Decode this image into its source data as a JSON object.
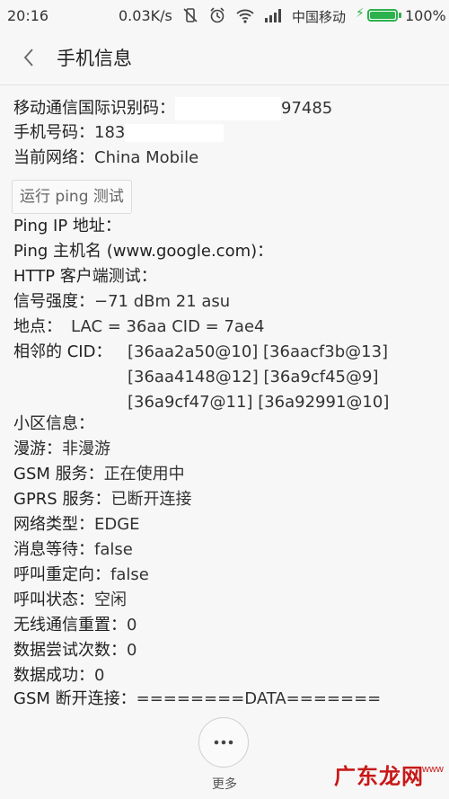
{
  "status_bar": {
    "time": "20:16",
    "net_speed": "0.03K/s",
    "carrier": "中国移动",
    "battery_pct": "100%",
    "battery_level": 1.0
  },
  "header": {
    "title": "手机信息"
  },
  "info": {
    "imei_label": "移动通信国际识别码：",
    "imei_value": "97485",
    "phone_label": "手机号码：",
    "phone_value": "183",
    "network_label": "当前网络：",
    "network_value": "China Mobile",
    "ping_button": "运行 ping 测试",
    "ping_ip_label": "Ping IP 地址：",
    "ping_host_label": "Ping 主机名 (www.google.com)：",
    "http_label": "HTTP 客户端测试：",
    "signal_label": "信号强度：",
    "signal_value": "−71 dBm   21 asu",
    "location_label": "地点：",
    "location_value": "LAC = 36aa   CID = 7ae4",
    "neighbor_label": "相邻的 CID：",
    "neighbor_cids": [
      "[36aa2a50@10] [36aacf3b@13]",
      "[36aa4148@12] [36a9cf45@9]",
      "[36a9cf47@11] [36a92991@10]"
    ],
    "cell_label": "小区信息：",
    "roaming_label": "漫游：",
    "roaming_value": "非漫游",
    "gsm_label": "GSM 服务：",
    "gsm_value": "正在使用中",
    "gprs_label": "GPRS 服务：",
    "gprs_value": "已断开连接",
    "nettype_label": "网络类型：",
    "nettype_value": "EDGE",
    "msgwait_label": "消息等待：",
    "msgwait_value": "false",
    "redirect_label": "呼叫重定向：",
    "redirect_value": "false",
    "callstate_label": "呼叫状态：",
    "callstate_value": "空闲",
    "radio_reset_label": "无线通信重置：",
    "radio_reset_value": "0",
    "data_attempt_label": "数据尝试次数：",
    "data_attempt_value": "0",
    "data_success_label": "数据成功：",
    "data_success_value": "0",
    "gsm_disconnect_label": "GSM 断开连接：",
    "gsm_disconnect_value": "========DATA======="
  },
  "footer": {
    "more_label": "更多"
  },
  "watermark": {
    "text": "广东龙网",
    "sub": "www"
  }
}
